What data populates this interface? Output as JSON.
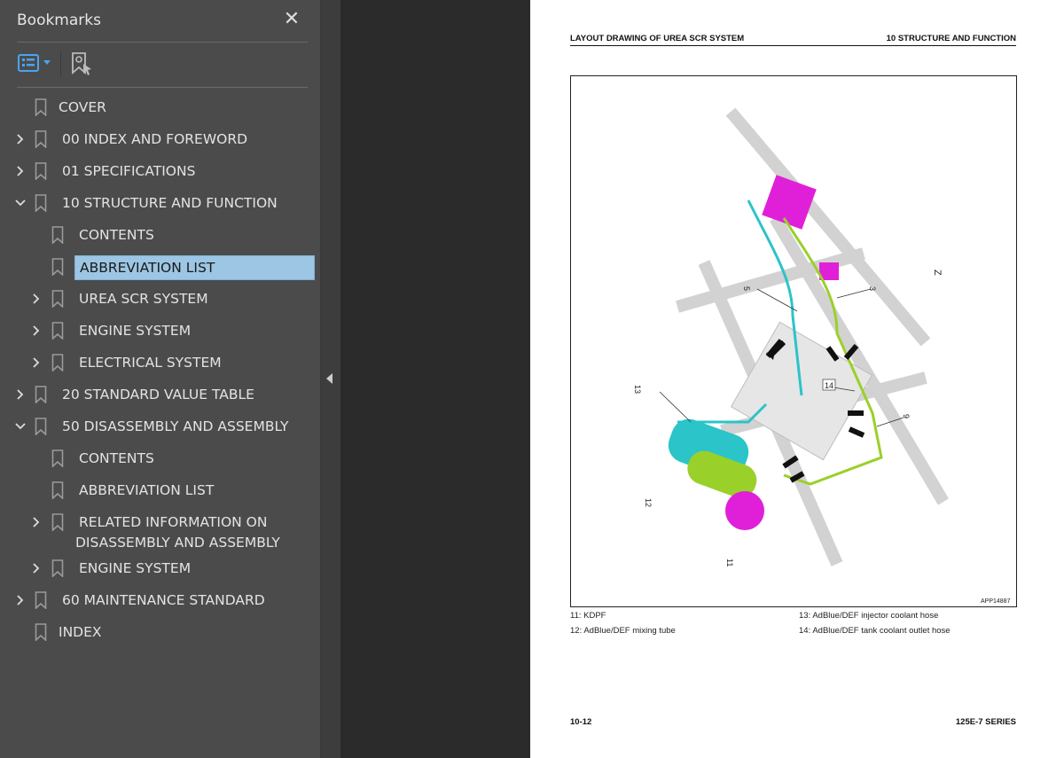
{
  "sidebar": {
    "title": "Bookmarks",
    "close_icon": "close-icon",
    "toolbar": {
      "options_icon": "list-options-icon",
      "find_icon": "find-current-bookmark-icon"
    },
    "items": [
      {
        "label": "COVER",
        "level": 0,
        "expander": "none"
      },
      {
        "label": "00 INDEX AND FOREWORD",
        "level": 0,
        "expander": "collapsed"
      },
      {
        "label": "01 SPECIFICATIONS",
        "level": 0,
        "expander": "collapsed"
      },
      {
        "label": "10 STRUCTURE AND FUNCTION",
        "level": 0,
        "expander": "expanded"
      },
      {
        "label": "CONTENTS",
        "level": 1,
        "expander": "none"
      },
      {
        "label": "ABBREVIATION LIST",
        "level": 1,
        "expander": "none",
        "selected": true
      },
      {
        "label": "UREA SCR SYSTEM",
        "level": 1,
        "expander": "collapsed"
      },
      {
        "label": "ENGINE SYSTEM",
        "level": 1,
        "expander": "collapsed"
      },
      {
        "label": "ELECTRICAL SYSTEM",
        "level": 1,
        "expander": "collapsed"
      },
      {
        "label": "20 STANDARD VALUE TABLE",
        "level": 0,
        "expander": "collapsed"
      },
      {
        "label": "50 DISASSEMBLY AND ASSEMBLY",
        "level": 0,
        "expander": "expanded"
      },
      {
        "label": "CONTENTS",
        "level": 1,
        "expander": "none"
      },
      {
        "label": "ABBREVIATION LIST",
        "level": 1,
        "expander": "none"
      },
      {
        "label": "RELATED INFORMATION ON",
        "label2": "DISASSEMBLY AND ASSEMBLY",
        "level": 1,
        "expander": "collapsed"
      },
      {
        "label": "ENGINE SYSTEM",
        "level": 1,
        "expander": "collapsed"
      },
      {
        "label": "60 MAINTENANCE STANDARD",
        "level": 0,
        "expander": "collapsed"
      },
      {
        "label": "INDEX",
        "level": 0,
        "expander": "none"
      }
    ]
  },
  "document": {
    "header_left": "LAYOUT DRAWING OF UREA SCR SYSTEM",
    "header_right": "10 STRUCTURE AND FUNCTION",
    "figure": {
      "id": "APP14887",
      "callouts": [
        "3",
        "5",
        "9",
        "11",
        "12",
        "13",
        "14"
      ],
      "orientation_mark": "Z"
    },
    "captions": [
      "11: KDPF",
      "12: AdBlue/DEF mixing tube",
      "13: AdBlue/DEF injector coolant hose",
      "14: AdBlue/DEF tank coolant outlet hose"
    ],
    "footer_left": "10-12",
    "footer_right": "125E-7 SERIES"
  },
  "colors": {
    "selection": "#9cc6e4",
    "accent": "#4aa3f5",
    "magenta": "#e000e0",
    "cyan": "#2bc4c8",
    "lime": "#9ad02a"
  }
}
